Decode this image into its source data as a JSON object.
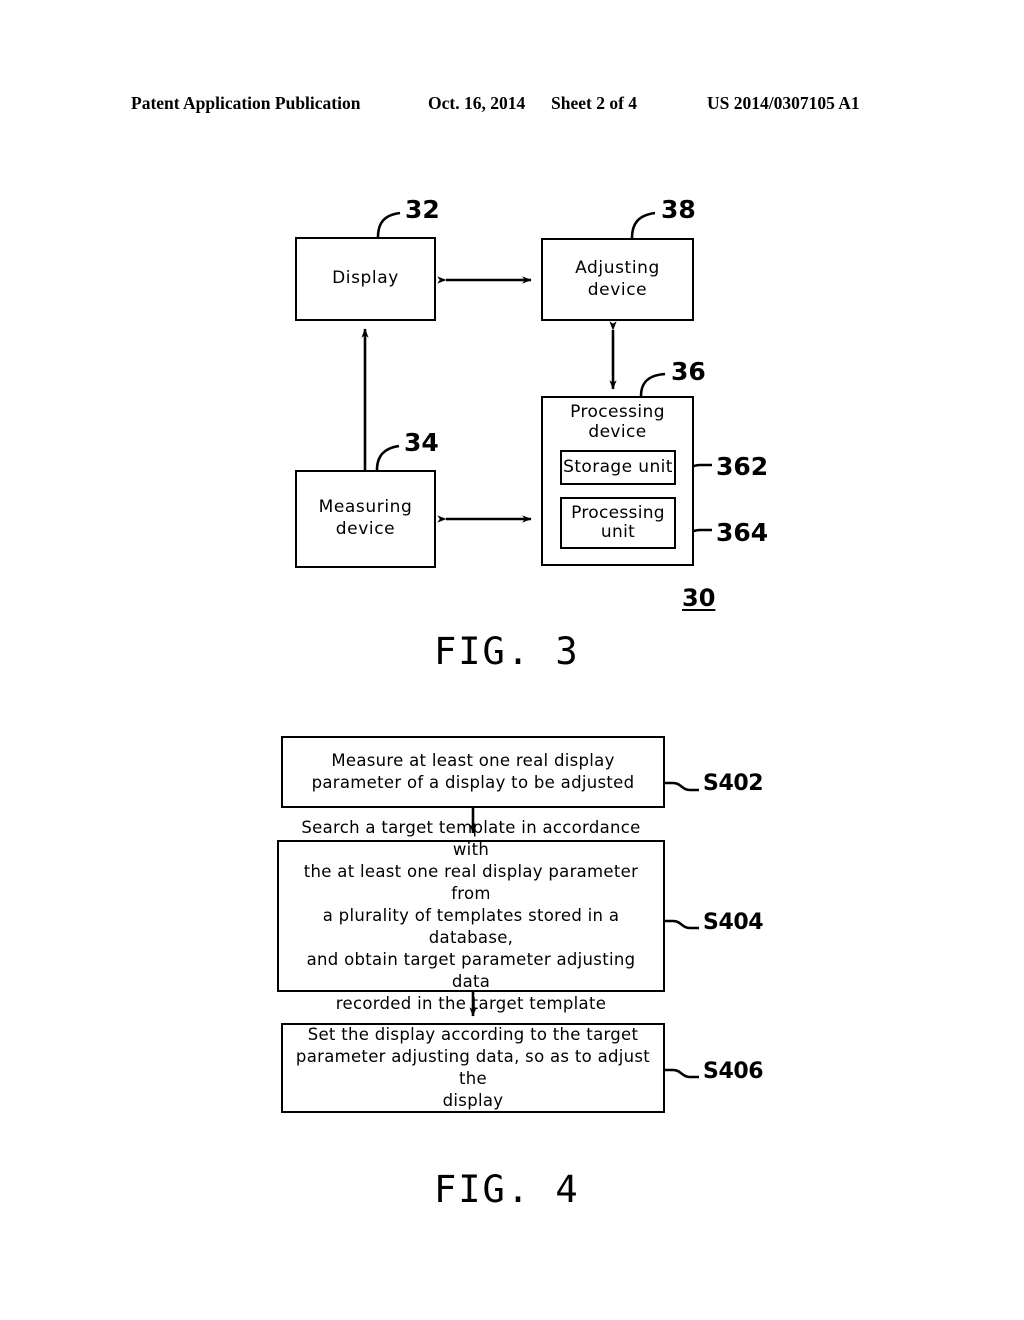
{
  "header": {
    "publication": "Patent Application Publication",
    "date": "Oct. 16, 2014",
    "sheet": "Sheet 2 of 4",
    "doc_number": "US 2014/0307105 A1"
  },
  "figure3": {
    "caption": "FIG. 3",
    "system_numeral": "30",
    "blocks": [
      {
        "id": "display",
        "label": "Display",
        "numeral": "32"
      },
      {
        "id": "adjusting",
        "label": "Adjusting  device",
        "numeral": "38"
      },
      {
        "id": "processing",
        "label": "Processing  device",
        "numeral": "36"
      },
      {
        "id": "measuring",
        "label": "Measuring  device",
        "numeral": "34"
      },
      {
        "id": "storage_unit",
        "label": "Storage unit",
        "numeral": "362"
      },
      {
        "id": "processing_unit",
        "label": "Processing\nunit",
        "numeral": "364"
      }
    ]
  },
  "figure4": {
    "caption": "FIG. 4",
    "steps": [
      {
        "id": "s402",
        "numeral": "S402",
        "text": "Measure at least one real display\nparameter of a display to be adjusted"
      },
      {
        "id": "s404",
        "numeral": "S404",
        "text": "Search a target template in accordance with\nthe at least one real display parameter from\na plurality of templates stored in a database,\nand obtain target parameter adjusting data\nrecorded in the target template"
      },
      {
        "id": "s406",
        "numeral": "S406",
        "text": "Set the display according to the target\nparameter adjusting data, so as to adjust the\ndisplay"
      }
    ]
  },
  "colors": {
    "ink": "#000000",
    "paper": "#ffffff"
  }
}
